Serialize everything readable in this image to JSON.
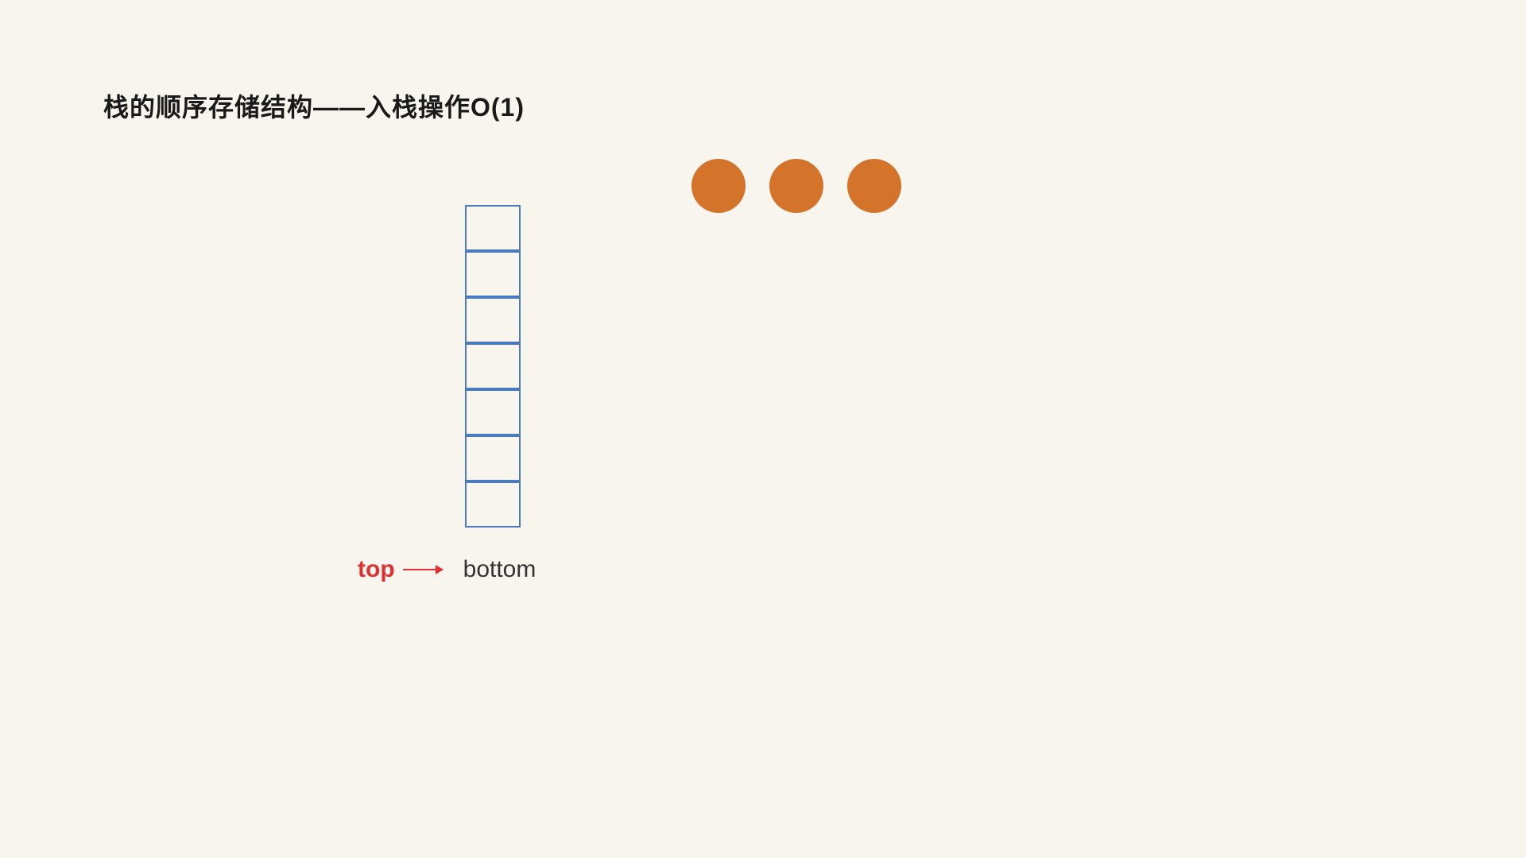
{
  "title": "栈的顺序存储结构——入栈操作O(1)",
  "circles": [
    {
      "id": "circle-1",
      "color": "#d4732a"
    },
    {
      "id": "circle-2",
      "color": "#d4732a"
    },
    {
      "id": "circle-3",
      "color": "#d4732a"
    }
  ],
  "stack": {
    "cells": 7,
    "border_color": "#4a7abf"
  },
  "labels": {
    "top": "top",
    "arrow": "→",
    "bottom": "bottom"
  }
}
